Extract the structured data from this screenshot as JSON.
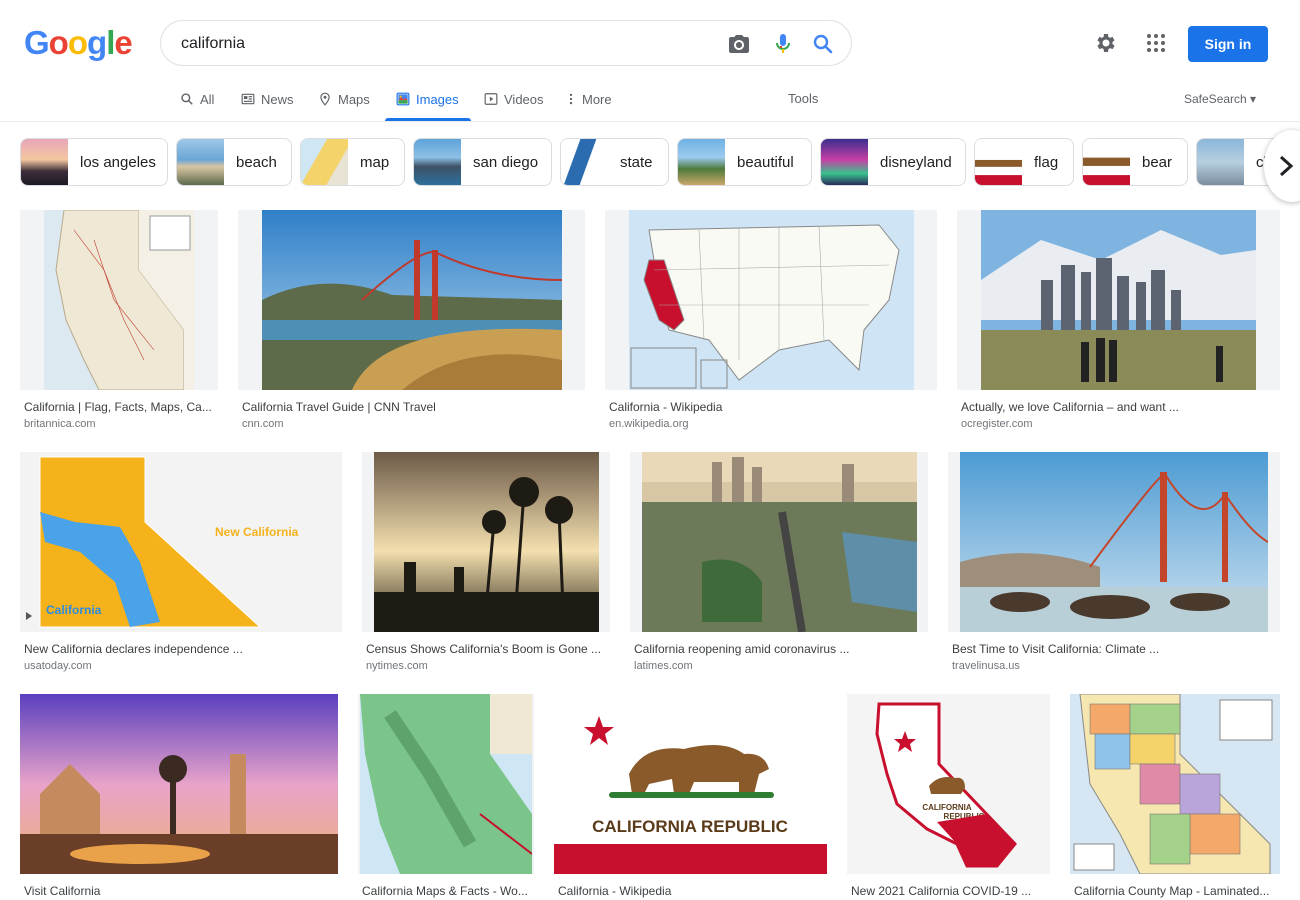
{
  "logo": {
    "letters": [
      "G",
      "o",
      "o",
      "g",
      "l",
      "e"
    ],
    "colors": [
      "#4285f4",
      "#ea4335",
      "#fbbc05",
      "#4285f4",
      "#34a853",
      "#ea4335"
    ]
  },
  "search": {
    "query": "california"
  },
  "header": {
    "signin_label": "Sign in"
  },
  "tabs": [
    {
      "label": "All",
      "icon": "search-icon"
    },
    {
      "label": "News",
      "icon": "news-icon"
    },
    {
      "label": "Maps",
      "icon": "map-pin-icon"
    },
    {
      "label": "Images",
      "icon": "images-icon",
      "active": true
    },
    {
      "label": "Videos",
      "icon": "video-icon"
    },
    {
      "label": "More",
      "icon": "more-dots-icon"
    }
  ],
  "tools_label": "Tools",
  "safesearch_label": "SafeSearch ▾",
  "chips": [
    {
      "label": "los angeles"
    },
    {
      "label": "beach"
    },
    {
      "label": "map"
    },
    {
      "label": "san diego"
    },
    {
      "label": "state"
    },
    {
      "label": "beautiful"
    },
    {
      "label": "disneyland"
    },
    {
      "label": "flag"
    },
    {
      "label": "bear"
    },
    {
      "label": "cl"
    }
  ],
  "results": [
    {
      "title": "California | Flag, Facts, Maps, Ca...",
      "source": "britannica.com",
      "kind": "map"
    },
    {
      "title": "California Travel Guide | CNN Travel",
      "source": "cnn.com",
      "kind": "bridge"
    },
    {
      "title": "California - Wikipedia",
      "source": "en.wikipedia.org",
      "kind": "usmap"
    },
    {
      "title": "Actually, we love California – and want ...",
      "source": "ocregister.com",
      "kind": "city"
    },
    {
      "title": "New California declares independence ...",
      "source": "usatoday.com",
      "kind": "newcal"
    },
    {
      "title": "Census Shows California's Boom is Gone ...",
      "source": "nytimes.com",
      "kind": "palms"
    },
    {
      "title": "California reopening amid coronavirus ...",
      "source": "latimes.com",
      "kind": "aerial"
    },
    {
      "title": "Best Time to Visit California: Climate ...",
      "source": "travelinusa.us",
      "kind": "bridge2"
    },
    {
      "title": "Visit California",
      "source": "",
      "kind": "sunset"
    },
    {
      "title": "California Maps & Facts - Wo...",
      "source": "",
      "kind": "topo"
    },
    {
      "title": "California - Wikipedia",
      "source": "",
      "kind": "flag"
    },
    {
      "title": "New 2021 California COVID-19 ...",
      "source": "",
      "kind": "stateflag"
    },
    {
      "title": "California County Map - Laminated...",
      "source": "",
      "kind": "counties"
    }
  ],
  "image_text": {
    "new_california": "New California",
    "california_label": "California",
    "flag_text": "CALIFORNIA REPUBLIC",
    "stateflag_text_1": "CALIFORNIA",
    "stateflag_text_2": "REPUBLIC"
  }
}
